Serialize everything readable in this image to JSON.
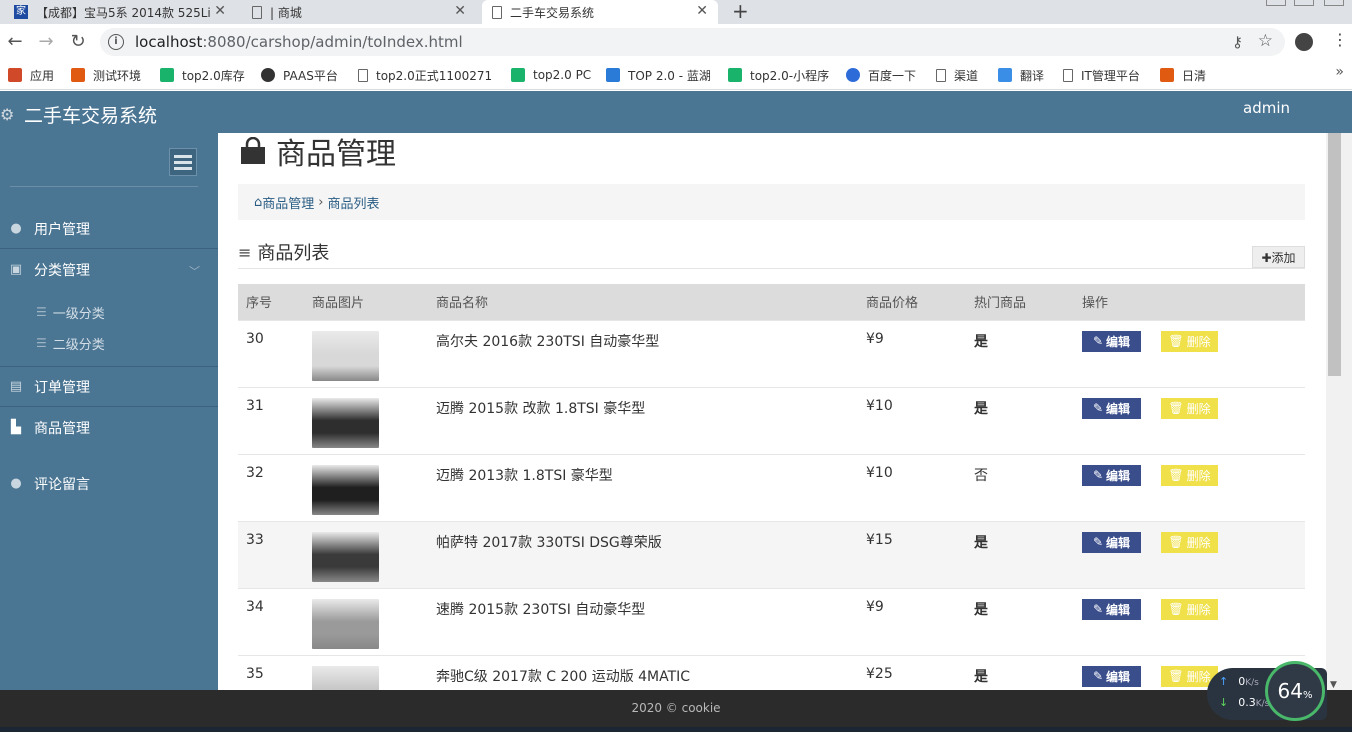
{
  "browser": {
    "tabs": [
      {
        "label": "【成都】宝马5系 2014款 525Li",
        "icon": "brand-icon"
      },
      {
        "label": "| 商城",
        "icon": "doc-icon"
      },
      {
        "label": "二手车交易系统",
        "icon": "doc-icon"
      }
    ],
    "new_tab": "+",
    "url_host": "localhost",
    "url_rest": ":8080/carshop/admin/toIndex.html",
    "bookmarks": [
      {
        "label": "应用",
        "color": "#d04a2a"
      },
      {
        "label": "测试环境",
        "color": "#e05a12"
      },
      {
        "label": "top2.0库存",
        "color": "#19b36b"
      },
      {
        "label": "PAAS平台",
        "color": "#333333"
      },
      {
        "label": "top2.0正式1100271",
        "color": "doc"
      },
      {
        "label": "top2.0 PC",
        "color": "#19b36b"
      },
      {
        "label": "TOP 2.0 - 蓝湖",
        "color": "#2a7ad8"
      },
      {
        "label": "top2.0-小程序",
        "color": "#19b36b"
      },
      {
        "label": "百度一下",
        "color": "#2d6cd8"
      },
      {
        "label": "渠道",
        "color": "doc"
      },
      {
        "label": "翻译",
        "color": "#3a8ee6"
      },
      {
        "label": "IT管理平台",
        "color": "doc"
      },
      {
        "label": "日清",
        "color": "#e05a12"
      }
    ],
    "bookmarks_more": "»"
  },
  "app": {
    "title": "二手车交易系统",
    "user": "admin",
    "header_color": "#4a7593"
  },
  "sidebar": {
    "items": [
      {
        "label": "用户管理",
        "icon": "user-icon"
      },
      {
        "label": "分类管理",
        "icon": "category-icon"
      },
      {
        "label": "订单管理",
        "icon": "file-icon"
      },
      {
        "label": "商品管理",
        "icon": "shopping-bag-icon"
      },
      {
        "label": "评论留言",
        "icon": "user-icon"
      }
    ],
    "subitems": [
      {
        "label": "一级分类"
      },
      {
        "label": "二级分类"
      }
    ]
  },
  "main": {
    "page_title": "商品管理",
    "breadcrumb": {
      "home": "商品管理",
      "sep": "›",
      "current": "商品列表"
    },
    "section_title": "商品列表",
    "add_button": "✚添加",
    "columns": [
      "序号",
      "商品图片",
      "商品名称",
      "商品价格",
      "热门商品",
      "操作"
    ],
    "rows": [
      {
        "id": "30",
        "name": "高尔夫 2016款 230TSI 自动豪华型",
        "price": "¥9",
        "hot": "是",
        "hot_flag": true,
        "thumb_color": "#d8d8d8"
      },
      {
        "id": "31",
        "name": "迈腾 2015款 改款 1.8TSI 豪华型",
        "price": "¥10",
        "hot": "是",
        "hot_flag": true,
        "thumb_color": "#2e2e2e"
      },
      {
        "id": "32",
        "name": "迈腾 2013款 1.8TSI 豪华型",
        "price": "¥10",
        "hot": "否",
        "hot_flag": false,
        "thumb_color": "#1f1f1f"
      },
      {
        "id": "33",
        "name": "帕萨特 2017款 330TSI DSG尊荣版",
        "price": "¥15",
        "hot": "是",
        "hot_flag": true,
        "thumb_color": "#3a3a3a"
      },
      {
        "id": "34",
        "name": "速腾 2015款 230TSI 自动豪华型",
        "price": "¥9",
        "hot": "是",
        "hot_flag": true,
        "thumb_color": "#9a9a9a"
      },
      {
        "id": "35",
        "name": "奔驰C级 2017款 C 200 运动版 4MATIC",
        "price": "¥25",
        "hot": "是",
        "hot_flag": true,
        "thumb_color": "#c8c8c8"
      }
    ],
    "edit_label": "编辑",
    "delete_label": "删除"
  },
  "footer": {
    "text": "2020 © cookie"
  },
  "netwidget": {
    "up": "0",
    "up_unit": "K/s",
    "down": "0.3",
    "down_unit": "K/s",
    "percent": "64",
    "percent_sign": "%"
  }
}
